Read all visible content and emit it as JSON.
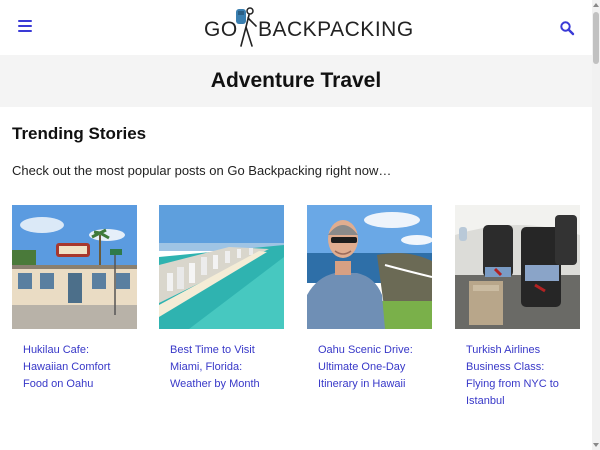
{
  "header": {
    "logo_go": "GO",
    "logo_rest": "BACKPACKING",
    "menu_icon": "hamburger-menu-icon",
    "search_icon": "search-icon",
    "accent_color": "#3a3ad6"
  },
  "banner": {
    "title": "Adventure Travel",
    "background": "#f4f4f4"
  },
  "main": {
    "section_title": "Trending Stories",
    "intro": "Check out the most popular posts on Go Backpacking right now…",
    "link_color": "#3838c8",
    "posts": [
      {
        "title": "Hukilau Cafe: Hawaiian Comfort Food on Oahu"
      },
      {
        "title": "Best Time to Visit Miami, Florida: Weather by Month"
      },
      {
        "title": "Oahu Scenic Drive: Ultimate One-Day Itinerary in Hawaii"
      },
      {
        "title": "Turkish Airlines Business Class: Flying from NYC to Istanbul"
      }
    ]
  }
}
